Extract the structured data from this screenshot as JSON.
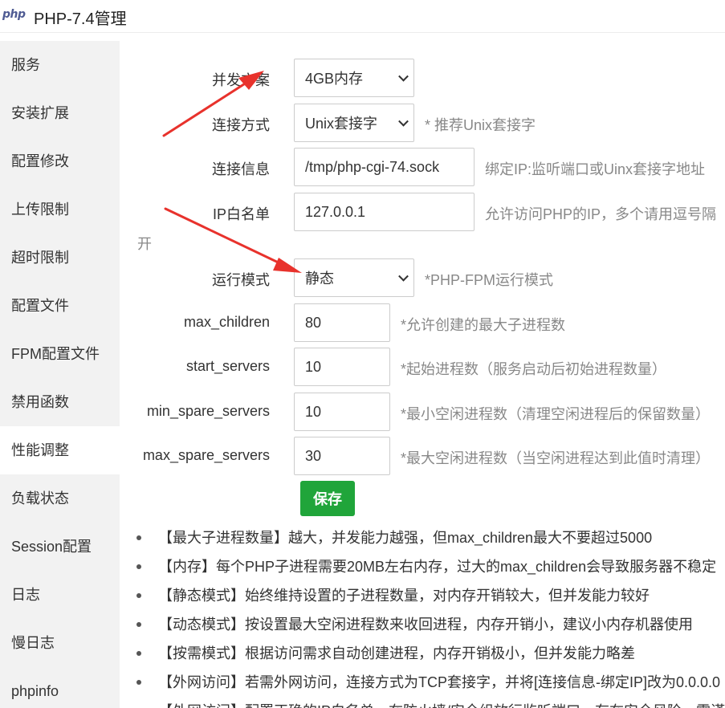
{
  "window": {
    "logo_text": "php",
    "title": "PHP-7.4管理"
  },
  "sidebar": {
    "items": [
      {
        "label": "服务"
      },
      {
        "label": "安装扩展"
      },
      {
        "label": "配置修改"
      },
      {
        "label": "上传限制"
      },
      {
        "label": "超时限制"
      },
      {
        "label": "配置文件"
      },
      {
        "label": "FPM配置文件"
      },
      {
        "label": "禁用函数"
      },
      {
        "label": "性能调整",
        "active": true
      },
      {
        "label": "负载状态"
      },
      {
        "label": "Session配置"
      },
      {
        "label": "日志"
      },
      {
        "label": "慢日志"
      },
      {
        "label": "phpinfo"
      }
    ]
  },
  "form": {
    "concurrency": {
      "label": "并发方案",
      "value": "4GB内存"
    },
    "connection_type": {
      "label": "连接方式",
      "value": "Unix套接字",
      "hint": "* 推荐Unix套接字"
    },
    "connection_info": {
      "label": "连接信息",
      "value": "/tmp/php-cgi-74.sock",
      "hint": "绑定IP:监听端口或Uinx套接字地址"
    },
    "ip_whitelist": {
      "label": "IP白名单",
      "value": "127.0.0.1",
      "hint_line1": "允许访问PHP的IP，多个请用逗号隔",
      "hint_line2": "开"
    },
    "run_mode": {
      "label": "运行模式",
      "value": "静态",
      "hint": "*PHP-FPM运行模式"
    },
    "max_children": {
      "label": "max_children",
      "value": "80",
      "hint": "*允许创建的最大子进程数"
    },
    "start_servers": {
      "label": "start_servers",
      "value": "10",
      "hint": "*起始进程数（服务启动后初始进程数量）"
    },
    "min_spare_servers": {
      "label": "min_spare_servers",
      "value": "10",
      "hint": "*最小空闲进程数（清理空闲进程后的保留数量）"
    },
    "max_spare_servers": {
      "label": "max_spare_servers",
      "value": "30",
      "hint": "*最大空闲进程数（当空闲进程达到此值时清理）"
    },
    "save_label": "保存"
  },
  "notes": [
    "【最大子进程数量】越大，并发能力越强，但max_children最大不要超过5000",
    "【内存】每个PHP子进程需要20MB左右内存，过大的max_children会导致服务器不稳定",
    "【静态模式】始终维持设置的子进程数量，对内存开销较大，但并发能力较好",
    "【动态模式】按设置最大空闲进程数来收回进程，内存开销小，建议小内存机器使用",
    "【按需模式】根据访问需求自动创建进程，内存开销极小，但并发能力略差",
    "【外网访问】若需外网访问，连接方式为TCP套接字，并将[连接信息-绑定IP]改为0.0.0.0",
    "【外网访问】配置正确的IP白名单，在防火墙/安全组放行监听端口，存在安全风险，需谨慎"
  ],
  "colors": {
    "accent_green": "#20a53a",
    "arrow_red": "#e8322c",
    "sidebar_bg": "#f2f2f2"
  }
}
